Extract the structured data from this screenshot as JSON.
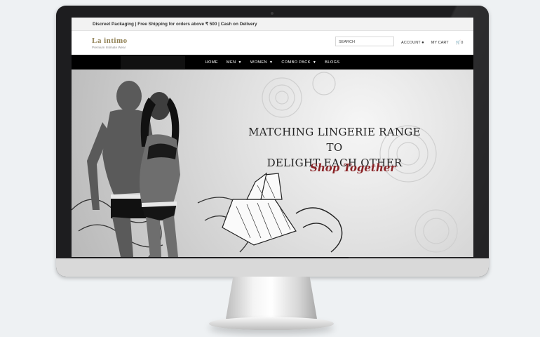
{
  "topbar": {
    "announcement": "Discreet Packaging | Free Shipping for orders above ₹ 500 | Cash on Delivery"
  },
  "header": {
    "logo": "La intimo",
    "tagline": "Premium Intimate Wear",
    "search_placeholder": "SEARCH",
    "account_label": "ACCOUNT",
    "cart_label": "MY CART",
    "cart_count": "0"
  },
  "nav": {
    "items": [
      {
        "label": "HOME"
      },
      {
        "label": "MEN"
      },
      {
        "label": "WOMEN"
      },
      {
        "label": "COMBO PACK"
      },
      {
        "label": "BLOGS"
      }
    ]
  },
  "hero": {
    "headline_line1": "MATCHING LINGERIE RANGE TO",
    "headline_line2": "DELIGHT EACH OTHER",
    "cta": "Shop Together"
  },
  "icons": {
    "user": "user-icon",
    "cart": "cart-icon",
    "caret": "chevron-down-icon"
  }
}
